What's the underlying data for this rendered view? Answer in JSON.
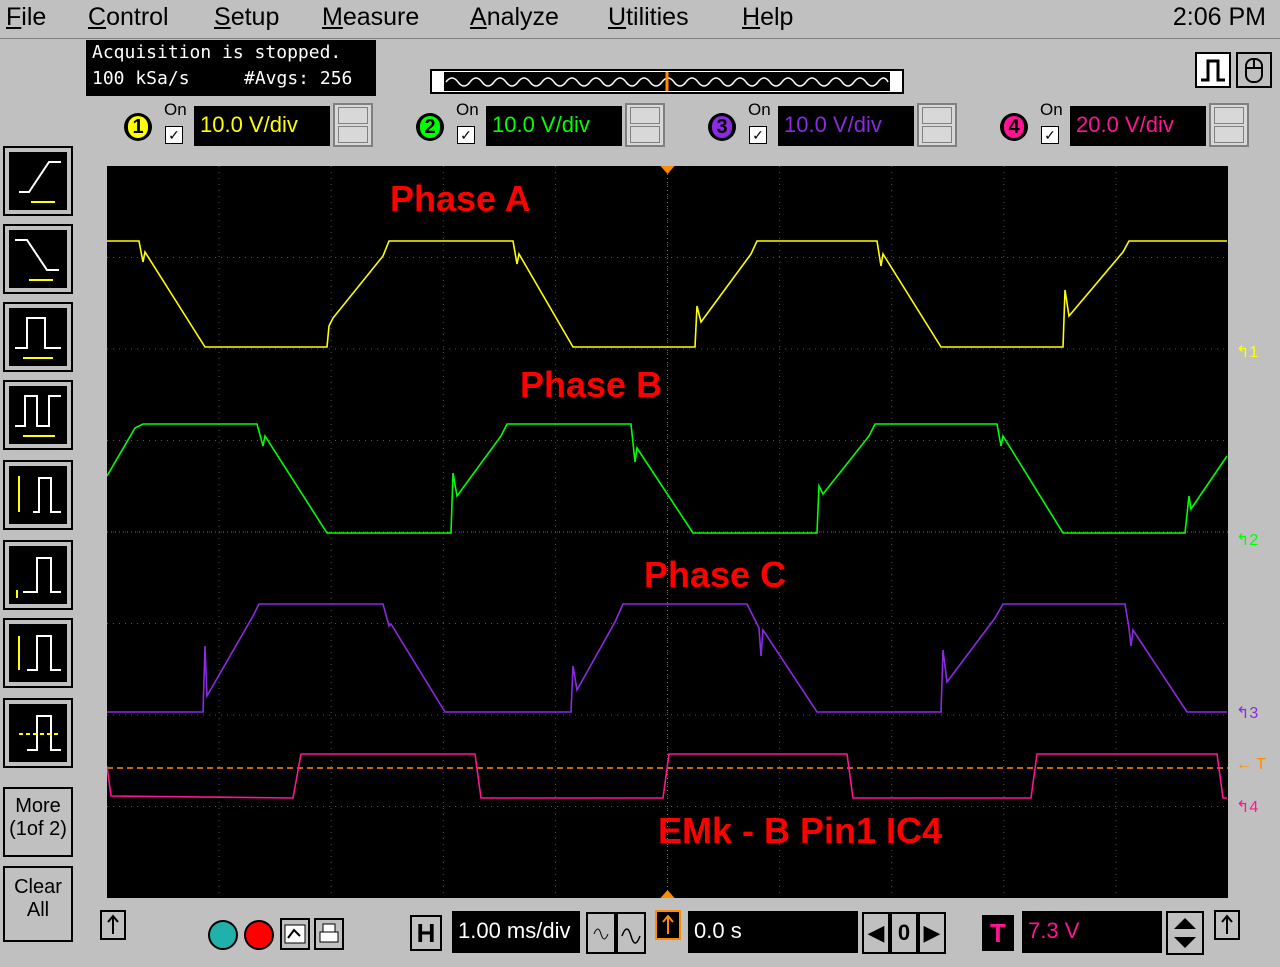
{
  "menu": {
    "items": [
      {
        "pre": "",
        "ul": "F",
        "post": "ile"
      },
      {
        "pre": "",
        "ul": "C",
        "post": "ontrol"
      },
      {
        "pre": "",
        "ul": "S",
        "post": "etup"
      },
      {
        "pre": "",
        "ul": "M",
        "post": "easure"
      },
      {
        "pre": "",
        "ul": "A",
        "post": "nalyze"
      },
      {
        "pre": "",
        "ul": "U",
        "post": "tilities"
      },
      {
        "pre": "",
        "ul": "H",
        "post": "elp"
      }
    ],
    "clock": "2:06 PM"
  },
  "status": {
    "acquisition": "Acquisition is stopped.",
    "sample_rate": "100 kSa/s",
    "averages": "#Avgs: 256"
  },
  "channels": [
    {
      "num": "1",
      "on_label": "On",
      "scale": "10.0 V/div",
      "color": "#ffff00",
      "enabled": true
    },
    {
      "num": "2",
      "on_label": "On",
      "scale": "10.0 V/div",
      "color": "#00ff00",
      "enabled": true
    },
    {
      "num": "3",
      "on_label": "On",
      "scale": "10.0 V/div",
      "color": "#8a2be2",
      "enabled": true
    },
    {
      "num": "4",
      "on_label": "On",
      "scale": "20.0 V/div",
      "color": "#ff1493",
      "enabled": true
    }
  ],
  "side_panel": {
    "more": "More (1of 2)",
    "more_line1": "More",
    "more_line2": "(1of 2)",
    "clear_line1": "Clear",
    "clear_line2": "All",
    "icons": [
      "rising-edge-icon",
      "falling-edge-icon",
      "pulse-width-icon",
      "period-icon",
      "rise-time-icon",
      "overshoot-icon",
      "amplitude-icon",
      "average-icon"
    ]
  },
  "annotations": {
    "phase_a": "Phase A",
    "phase_b": "Phase B",
    "phase_c": "Phase C",
    "emk": "EMk - B Pin1 IC4"
  },
  "markers": {
    "ch1": "1",
    "ch2": "2",
    "ch3": "3",
    "ch4": "4",
    "trigger": "T"
  },
  "timebase": {
    "h_label": "H",
    "scale": "1.00 ms/div",
    "position": "0.0 s",
    "delay_ref": "0"
  },
  "trigger": {
    "t_label": "T",
    "level": "7.3 V"
  },
  "colors": {
    "ch1": "#ffff00",
    "ch2": "#00ff00",
    "ch3": "#8a2be2",
    "ch4": "#ff1493",
    "annotation": "#ff0000",
    "trigger_line": "#ff8c00"
  }
}
